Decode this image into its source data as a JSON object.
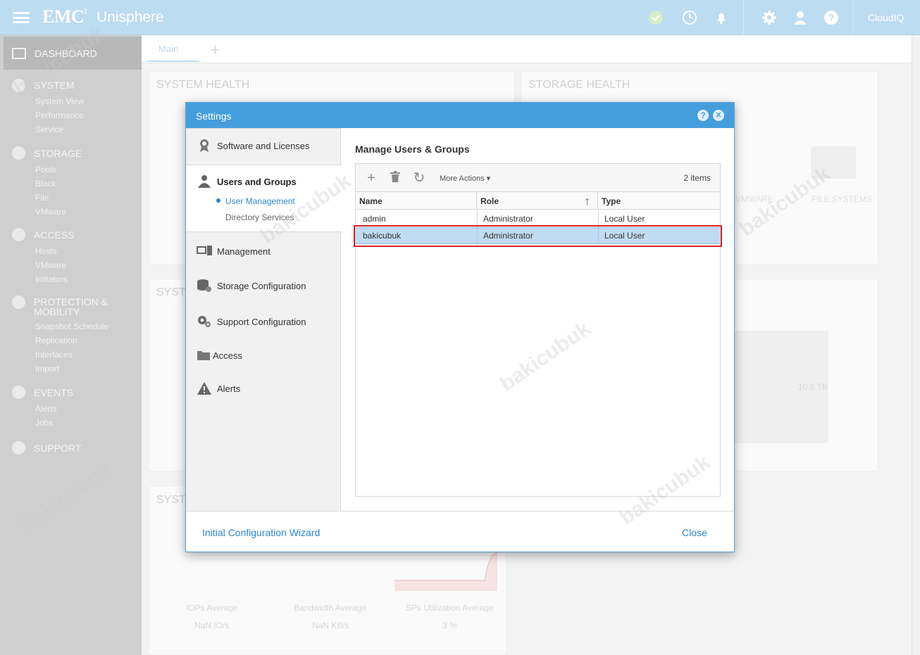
{
  "header": {
    "brand": "EMC",
    "brand_sup": "2",
    "product": "Unisphere",
    "cloudiq": "CloudIQ",
    "icons": [
      "health-check-icon",
      "jobs-clock-icon",
      "alerts-bell-icon",
      "settings-gear-icon",
      "user-icon",
      "help-icon"
    ]
  },
  "sidebar": {
    "dashboard": "DASHBOARD",
    "groups": [
      {
        "label": "SYSTEM",
        "items": [
          "System View",
          "Performance",
          "Service"
        ]
      },
      {
        "label": "STORAGE",
        "items": [
          "Pools",
          "Block",
          "File",
          "VMware"
        ]
      },
      {
        "label": "ACCESS",
        "items": [
          "Hosts",
          "VMware",
          "Initiators"
        ]
      },
      {
        "label": "PROTECTION &",
        "label2": "MOBILITY",
        "items": [
          "Snapshot Schedule",
          "Replication",
          "Interfaces",
          "Import"
        ]
      },
      {
        "label": "EVENTS",
        "items": [
          "Alerts",
          "Jobs"
        ]
      },
      {
        "label": "SUPPORT",
        "items": []
      }
    ]
  },
  "tabs": {
    "main": "Main",
    "add": "+"
  },
  "background": {
    "system_health": "SYSTEM HEALTH",
    "storage_health": "STORAGE HEALTH",
    "syst_2": "SYST",
    "syst_3": "SYST",
    "vmware_label": "VMWARE",
    "file_systems": "FILE SYSTEMS",
    "capacity": "10.6 TB",
    "iops_label": "IOPs Average",
    "iops_value": "NaN IO/s",
    "bandwidth_label": "Bandwidth Average",
    "bandwidth_value": "NaN KB/s",
    "sp_label": "SPs Utilization Average",
    "sp_value": "3 %"
  },
  "dialog": {
    "title": "Settings",
    "help": "?",
    "close_x": "✕",
    "nav": {
      "software": "Software and Licenses",
      "users_groups": "Users and Groups",
      "user_management": "User Management",
      "directory_services": "Directory Services",
      "management": "Management",
      "storage_config": "Storage Configuration",
      "support_config": "Support Configuration",
      "access": "Access",
      "alerts": "Alerts"
    },
    "content_title": "Manage Users & Groups",
    "toolbar": {
      "add": "+",
      "delete": "🗑",
      "refresh": "↻",
      "more_actions": "More Actions ▾",
      "count": "2 items"
    },
    "columns": [
      "Name",
      "Role",
      "Type"
    ],
    "rows": [
      {
        "name": "admin",
        "role": "Administrator",
        "type": "Local User"
      },
      {
        "name": "bakicubuk",
        "role": "Administrator",
        "type": "Local User"
      }
    ],
    "footer": {
      "wizard": "Initial Configuration Wizard",
      "close": "Close"
    }
  },
  "watermark": "bakicubuk",
  "colors": {
    "header": "#bcdcf2",
    "dialog_header": "#459edc",
    "link": "#2a87cf",
    "selected_row": "#bfdcf3",
    "highlight": "#d9202a"
  }
}
